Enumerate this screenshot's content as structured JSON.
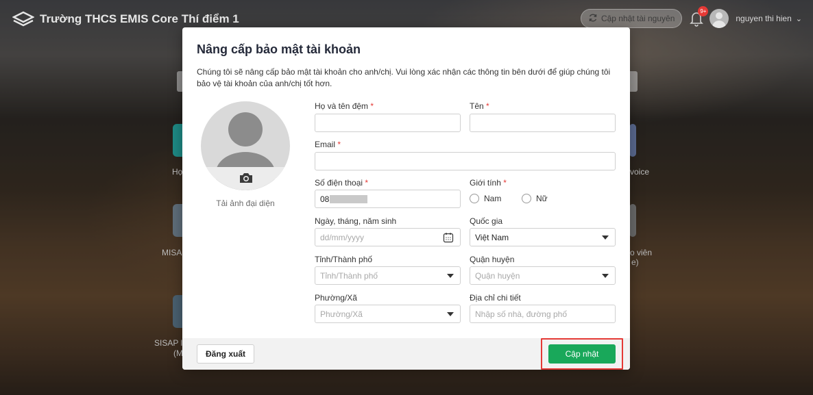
{
  "app": {
    "title": "Trường THCS EMIS Core Thí điểm 1"
  },
  "header": {
    "update_resources_label": "Cập nhật tài nguyên",
    "notification_badge": "9+",
    "username": "nguyen thi hien"
  },
  "background_labels": [
    "Họ",
    "voice",
    "MISA",
    "o viên",
    "e)",
    "SISAP l",
    "(M"
  ],
  "modal": {
    "title": "Nâng cấp bảo mật tài khoản",
    "description": "Chúng tôi sẽ nâng cấp bảo mật tài khoản cho anh/chị. Vui lòng xác nhận các thông tin bên dưới để giúp chúng tôi bảo vệ tài khoản của anh/chị tốt hơn.",
    "upload_avatar_label": "Tải ảnh đại diện",
    "fields": {
      "last_name": {
        "label": "Họ và tên đệm",
        "value": ""
      },
      "first_name": {
        "label": "Tên",
        "value": ""
      },
      "email": {
        "label": "Email",
        "value": ""
      },
      "phone": {
        "label": "Số điện thoại",
        "value": "08"
      },
      "gender": {
        "label": "Giới tính",
        "options": [
          "Nam",
          "Nữ"
        ]
      },
      "dob": {
        "label": "Ngày, tháng, năm sinh",
        "placeholder": "dd/mm/yyyy"
      },
      "country": {
        "label": "Quốc gia",
        "value": "Việt Nam"
      },
      "province": {
        "label": "Tỉnh/Thành phố",
        "placeholder": "Tỉnh/Thành phố"
      },
      "district": {
        "label": "Quận huyện",
        "placeholder": "Quận huyện"
      },
      "ward": {
        "label": "Phường/Xã",
        "placeholder": "Phường/Xã"
      },
      "address": {
        "label": "Địa chỉ chi tiết",
        "placeholder": "Nhập số nhà, đường phố"
      }
    },
    "required_mark": "*",
    "logout_label": "Đăng xuất",
    "update_label": "Cập nhật"
  },
  "colors": {
    "primary": "#19a85a",
    "required": "#e53935",
    "highlight": "#e53935"
  }
}
